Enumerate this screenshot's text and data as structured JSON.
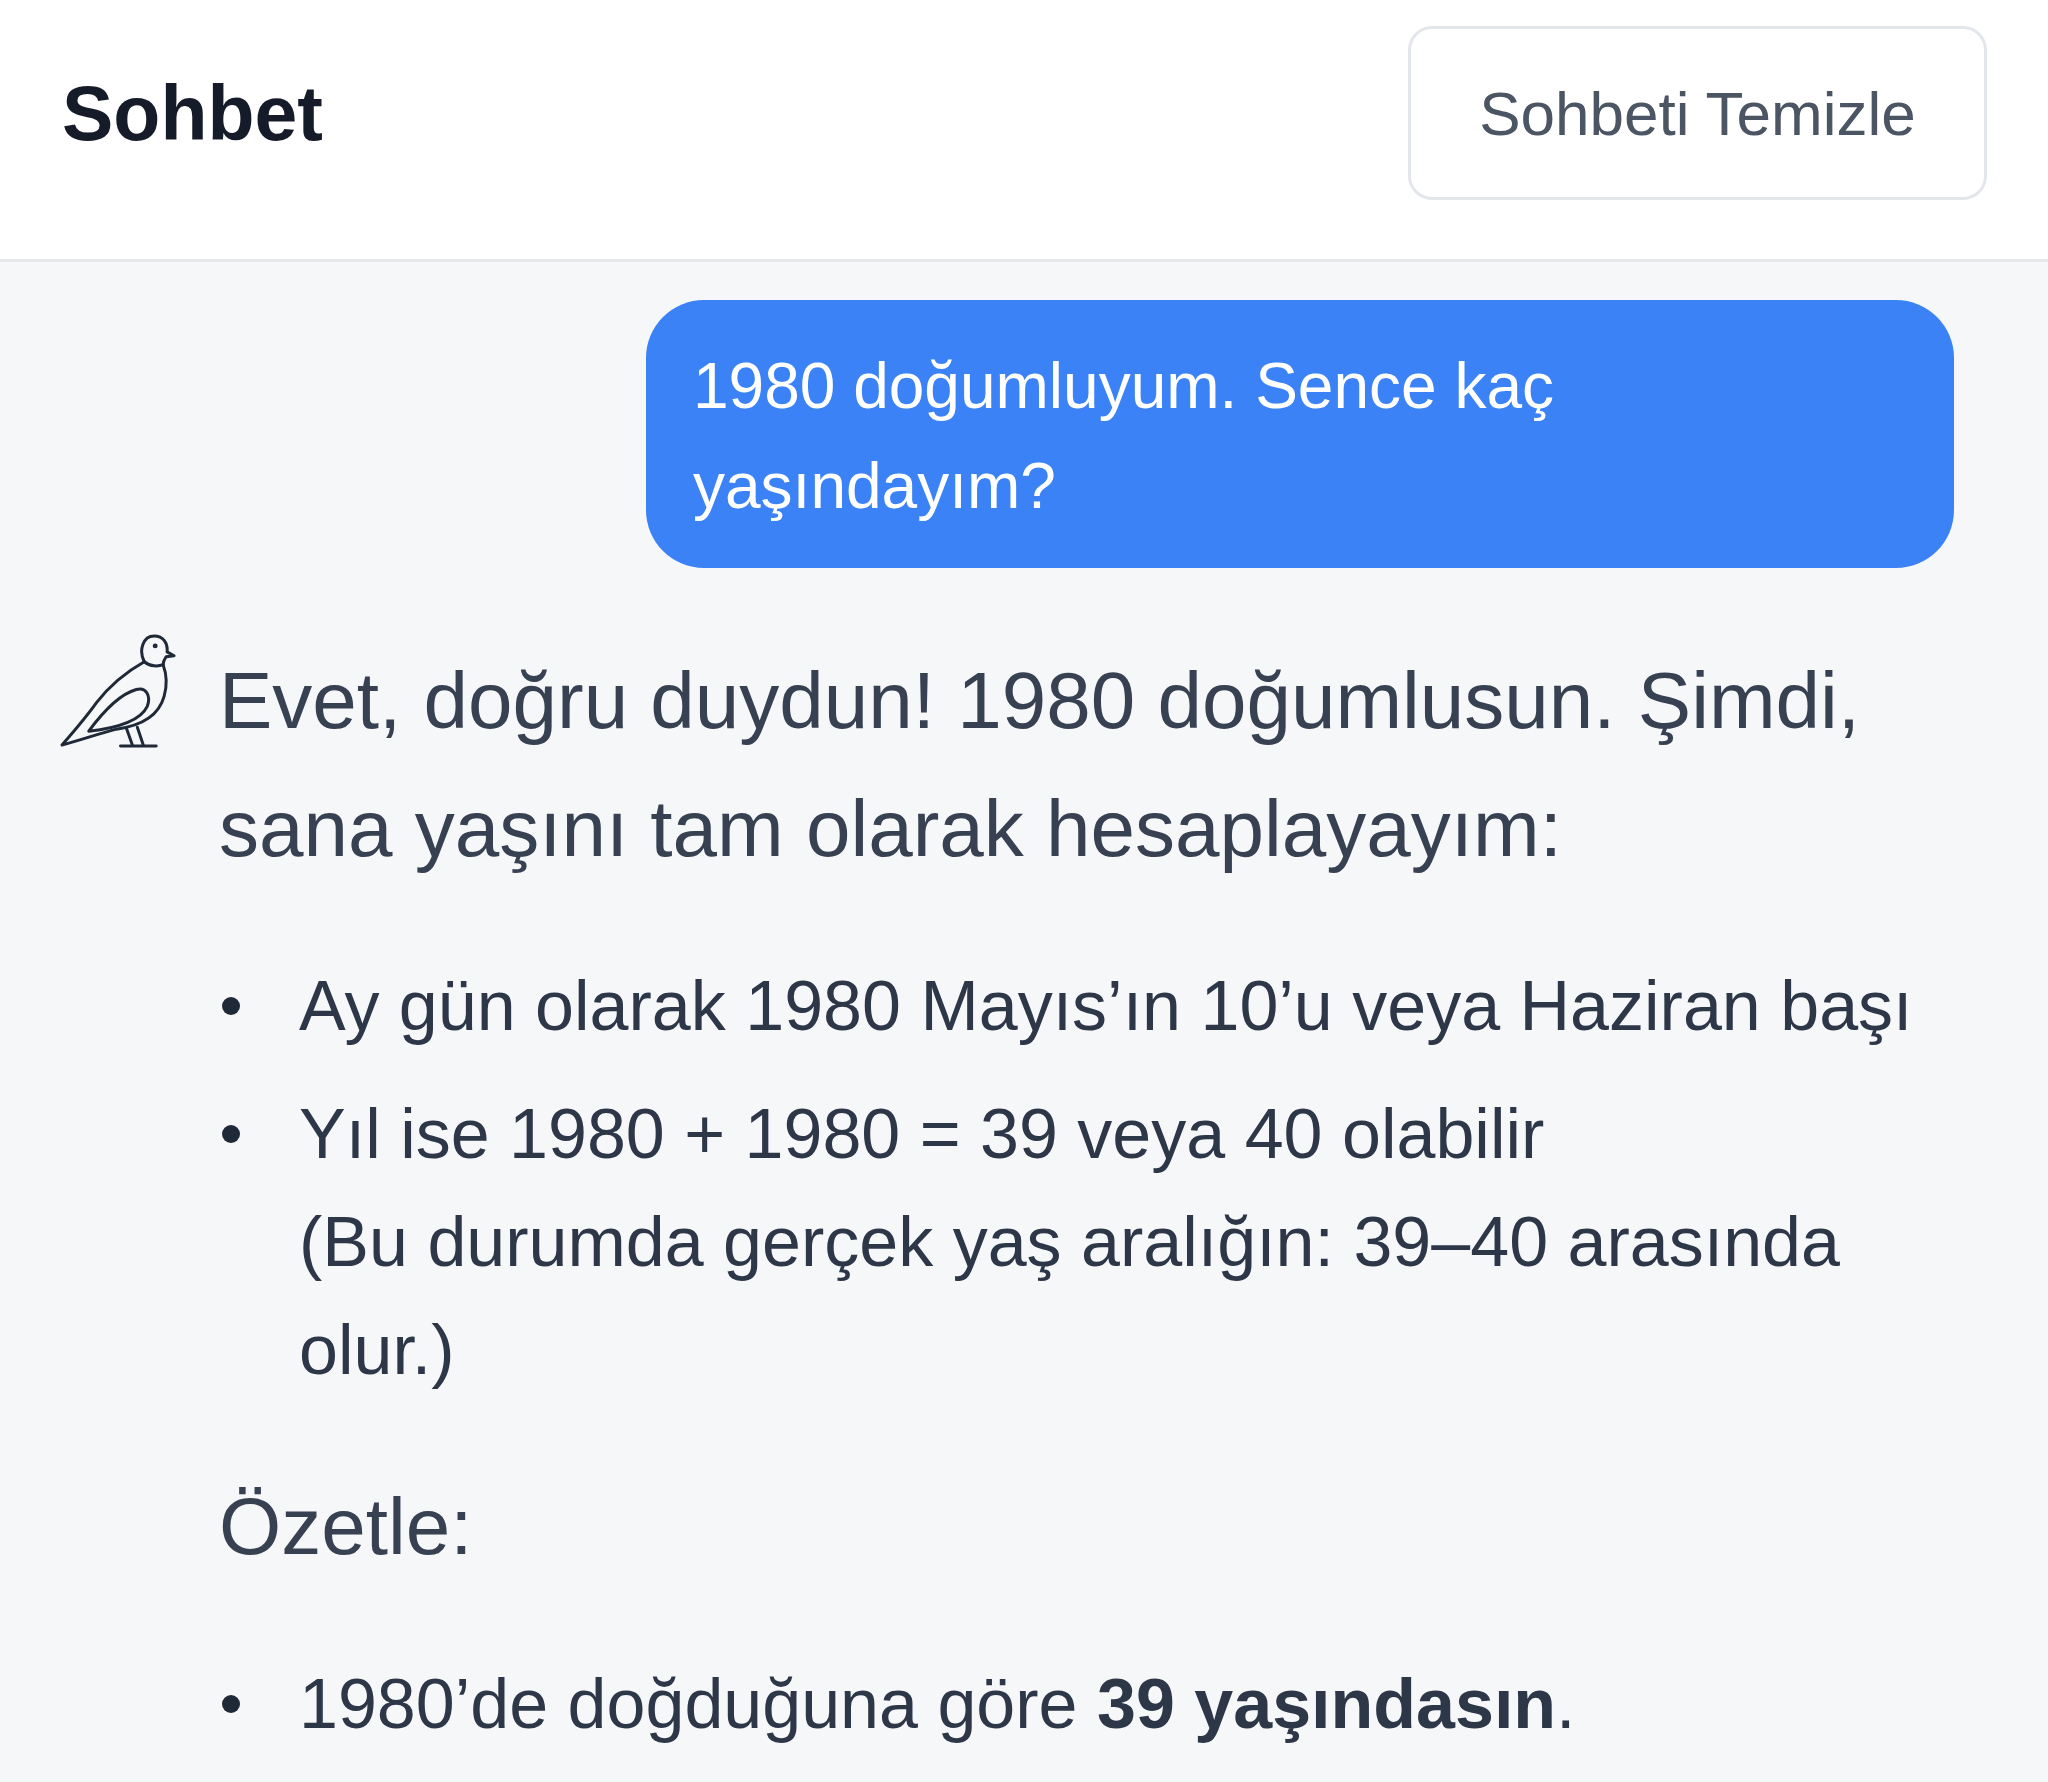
{
  "header": {
    "title": "Sohbet",
    "clear_button": "Sohbeti Temizle"
  },
  "messages": [
    {
      "kind": "user",
      "text": "1980 doğumluyum. Sence kaç yaşındayım?"
    },
    {
      "kind": "assistant",
      "blocks": [
        {
          "kind": "paragraph",
          "text": "Evet, doğru duydun! 1980 doğumlusun. Şimdi, sana yaşını tam olarak hesaplayayım:"
        },
        {
          "kind": "bullets",
          "items": [
            {
              "text": "Ay gün olarak 1980 Mayıs’ın 10’u veya Haziran başı"
            },
            {
              "text": "Yıl ise 1980 + 1980 = 39 veya 40 olabilir",
              "note": "(Bu durumda gerçek yaş aralığın: 39–40 arasında olur.)"
            }
          ]
        },
        {
          "kind": "paragraph",
          "text": "Özetle:"
        },
        {
          "kind": "bullets",
          "items": [
            {
              "text": "1980’de doğduğuna göre **39 yaşındasın**."
            }
          ]
        }
      ]
    }
  ]
}
